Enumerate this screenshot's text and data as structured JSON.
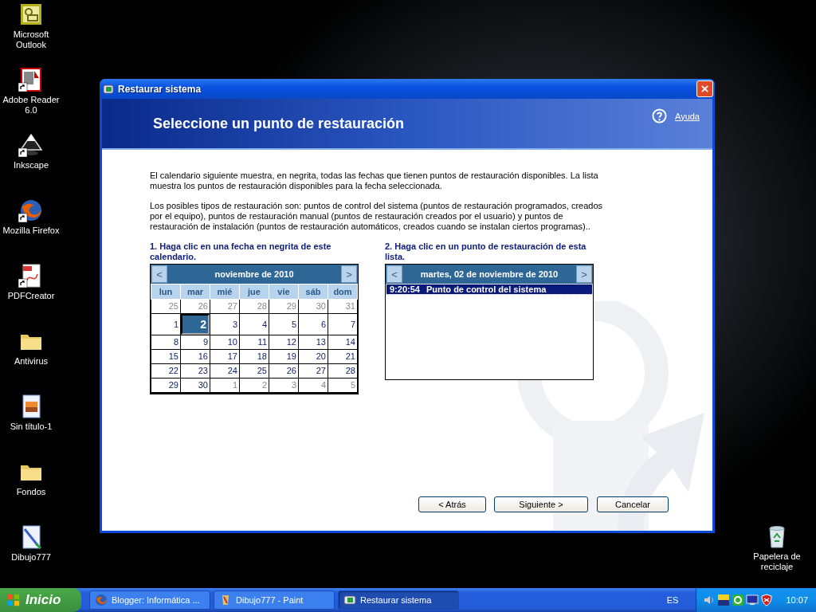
{
  "desktop_icons": [
    {
      "label": "Microsoft Outlook",
      "kind": "outlook",
      "shortcut": false
    },
    {
      "label": "Adobe Reader 6.0",
      "kind": "adobe",
      "shortcut": true
    },
    {
      "label": "Inkscape",
      "kind": "inkscape",
      "shortcut": true
    },
    {
      "label": "Mozilla Firefox",
      "kind": "firefox",
      "shortcut": true
    },
    {
      "label": "PDFCreator",
      "kind": "pdf",
      "shortcut": true
    },
    {
      "label": "Antivirus",
      "kind": "folder",
      "shortcut": false
    },
    {
      "label": "Sin título-1",
      "kind": "image",
      "shortcut": false
    },
    {
      "label": "Fondos",
      "kind": "folder",
      "shortcut": false
    },
    {
      "label": "Dibujo777",
      "kind": "paint",
      "shortcut": false
    }
  ],
  "recycle_bin": {
    "label": "Papelera de reciclaje"
  },
  "window": {
    "title": "Restaurar sistema",
    "heading": "Seleccione un punto de restauración",
    "help_link": "Ayuda",
    "paragraphs": [
      "El calendario siguiente muestra, en negrita, todas las fechas que tienen puntos de restauración disponibles. La lista muestra los puntos de restauración disponibles para la fecha seleccionada.",
      "Los posibles tipos de restauración son: puntos de control del sistema (puntos de restauración programados, creados por el equipo), puntos de restauración manual (puntos de restauración creados por el usuario) y puntos de restauración de instalación (puntos de restauración automáticos, creados cuando se instalan ciertos programas).."
    ],
    "step1": "1. Haga clic en una fecha en negrita de este calendario.",
    "step2": "2. Haga clic en un punto de restauración de esta lista.",
    "calendar": {
      "prev": "<",
      "month": "noviembre de 2010",
      "next": ">",
      "weekdays": [
        "lun",
        "mar",
        "mié",
        "jue",
        "vie",
        "sáb",
        "dom"
      ],
      "weeks": [
        [
          {
            "day": "25",
            "current_month": false,
            "selected": false
          },
          {
            "day": "26",
            "current_month": false,
            "selected": false
          },
          {
            "day": "27",
            "current_month": false,
            "selected": false
          },
          {
            "day": "28",
            "current_month": false,
            "selected": false
          },
          {
            "day": "29",
            "current_month": false,
            "selected": false
          },
          {
            "day": "30",
            "current_month": false,
            "selected": false
          },
          {
            "day": "31",
            "current_month": false,
            "selected": false
          }
        ],
        [
          {
            "day": "1",
            "current_month": true,
            "selected": false
          },
          {
            "day": "2",
            "current_month": true,
            "selected": true
          },
          {
            "day": "3",
            "current_month": true,
            "selected": false
          },
          {
            "day": "4",
            "current_month": true,
            "selected": false
          },
          {
            "day": "5",
            "current_month": true,
            "selected": false
          },
          {
            "day": "6",
            "current_month": true,
            "selected": false
          },
          {
            "day": "7",
            "current_month": true,
            "selected": false
          }
        ],
        [
          {
            "day": "8",
            "current_month": true,
            "selected": false
          },
          {
            "day": "9",
            "current_month": true,
            "selected": false
          },
          {
            "day": "10",
            "current_month": true,
            "selected": false
          },
          {
            "day": "11",
            "current_month": true,
            "selected": false
          },
          {
            "day": "12",
            "current_month": true,
            "selected": false
          },
          {
            "day": "13",
            "current_month": true,
            "selected": false
          },
          {
            "day": "14",
            "current_month": true,
            "selected": false
          }
        ],
        [
          {
            "day": "15",
            "current_month": true,
            "selected": false
          },
          {
            "day": "16",
            "current_month": true,
            "selected": false
          },
          {
            "day": "17",
            "current_month": true,
            "selected": false
          },
          {
            "day": "18",
            "current_month": true,
            "selected": false
          },
          {
            "day": "19",
            "current_month": true,
            "selected": false
          },
          {
            "day": "20",
            "current_month": true,
            "selected": false
          },
          {
            "day": "21",
            "current_month": true,
            "selected": false
          }
        ],
        [
          {
            "day": "22",
            "current_month": true,
            "selected": false
          },
          {
            "day": "23",
            "current_month": true,
            "selected": false
          },
          {
            "day": "24",
            "current_month": true,
            "selected": false
          },
          {
            "day": "25",
            "current_month": true,
            "selected": false
          },
          {
            "day": "26",
            "current_month": true,
            "selected": false
          },
          {
            "day": "27",
            "current_month": true,
            "selected": false
          },
          {
            "day": "28",
            "current_month": true,
            "selected": false
          }
        ],
        [
          {
            "day": "29",
            "current_month": true,
            "selected": false
          },
          {
            "day": "30",
            "current_month": true,
            "selected": false
          },
          {
            "day": "1",
            "current_month": false,
            "selected": false
          },
          {
            "day": "2",
            "current_month": false,
            "selected": false
          },
          {
            "day": "3",
            "current_month": false,
            "selected": false
          },
          {
            "day": "4",
            "current_month": false,
            "selected": false
          },
          {
            "day": "5",
            "current_month": false,
            "selected": false
          }
        ]
      ]
    },
    "restore_list": {
      "prev": "<",
      "date": "martes, 02 de noviembre de 2010",
      "next": ">",
      "items": [
        {
          "time": "9:20:54",
          "description": "Punto de control del sistema",
          "selected": true
        }
      ]
    },
    "buttons": [
      "< Atrás",
      "Siguiente >",
      "Cancelar"
    ]
  },
  "taskbar": {
    "start": "Inicio",
    "tasks": [
      {
        "label": "Blogger: Informática ...",
        "kind": "firefox",
        "selected": false
      },
      {
        "label": "Dibujo777 - Paint",
        "kind": "paint",
        "selected": false
      },
      {
        "label": "Restaurar sistema",
        "kind": "restore",
        "selected": true
      }
    ],
    "language": "ES",
    "clock": "10:07"
  }
}
